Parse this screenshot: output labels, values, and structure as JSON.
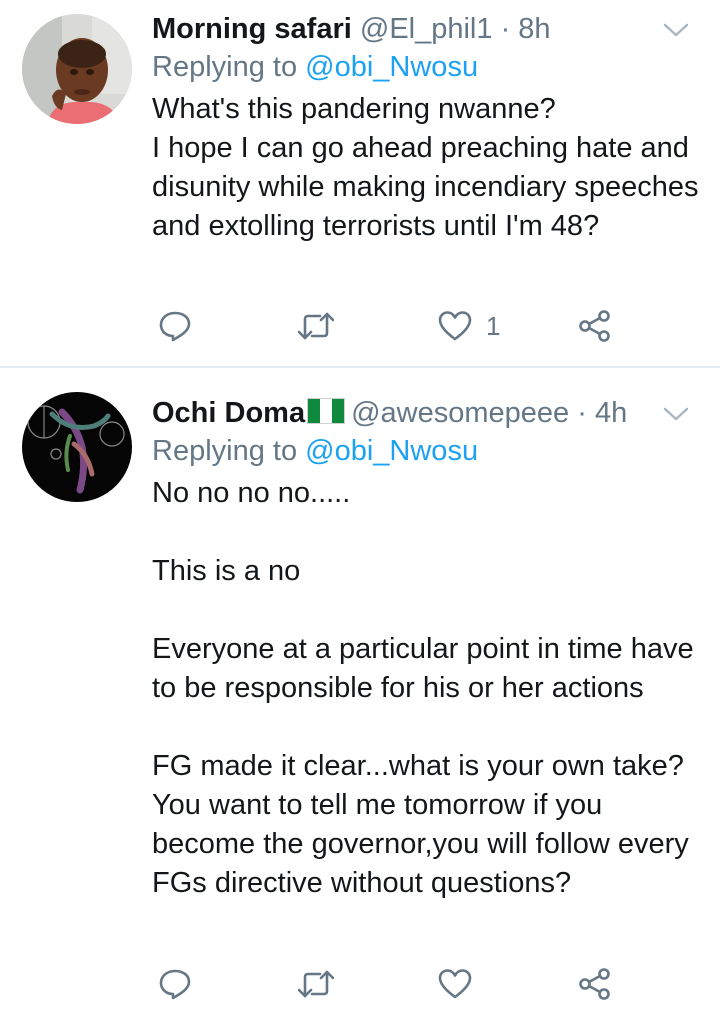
{
  "colors": {
    "text": "#14171a",
    "secondary": "#657786",
    "mention": "#1da1f2",
    "divider": "#e6ecf0"
  },
  "tweets": [
    {
      "name": "Morning safari",
      "handle": "@El_phil1",
      "separator": "·",
      "time": "8h",
      "replying_prefix": "Replying to ",
      "replying_to": "@obi_Nwosu",
      "text": "What's this pandering nwanne?\nI hope I can go ahead preaching hate and disunity while making incendiary speeches and extolling terrorists until I'm 48?",
      "reply_count": "",
      "retweet_count": "",
      "like_count": "1",
      "icons": [
        "reply-icon",
        "retweet-icon",
        "heart-icon",
        "share-icon",
        "chevron-down-icon"
      ]
    },
    {
      "name": "Ochi Doma",
      "name_flag": "nigeria-flag",
      "handle": "@awesomepeee",
      "separator": "·",
      "time": "4h",
      "replying_prefix": "Replying to ",
      "replying_to": "@obi_Nwosu",
      "text": "No no no no.....\n\nThis is a no\n\nEveryone at a particular point in time have to be responsible for his or her actions\n\nFG made it clear...what is your own take?\nYou want to tell me tomorrow if you become the governor,you will follow every FGs directive without questions?",
      "reply_count": "",
      "retweet_count": "",
      "like_count": "",
      "icons": [
        "reply-icon",
        "retweet-icon",
        "heart-icon",
        "share-icon",
        "chevron-down-icon"
      ]
    }
  ]
}
